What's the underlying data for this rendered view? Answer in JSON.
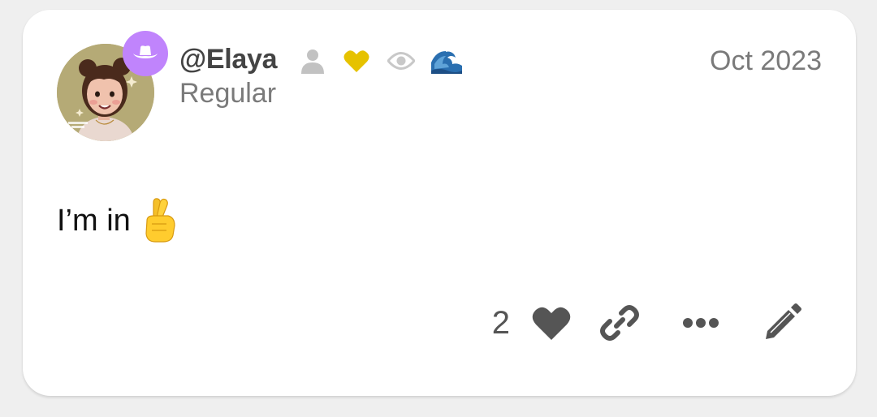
{
  "post": {
    "username": "@Elaya",
    "role": "Regular",
    "date": "Oct 2023",
    "message": "I’m in",
    "message_emoji": "crossed-fingers-emoji",
    "avatar_icon": "user-avatar",
    "flair_icon": "cowboy-hat-icon",
    "badges": [
      {
        "icon": "person-icon",
        "color": "#c2c2c2"
      },
      {
        "icon": "heart-icon",
        "color": "#e6c200"
      },
      {
        "icon": "eye-icon",
        "color": "#c8c8c8"
      },
      {
        "icon": "wave-emoji",
        "color": "#2a6fb0"
      }
    ]
  },
  "actions": {
    "like_count": "2",
    "icons": [
      "heart-icon",
      "link-icon",
      "more-icon",
      "edit-icon"
    ]
  },
  "colors": {
    "background": "#efefef",
    "card": "#ffffff",
    "flair": "#c084fc",
    "action_icon": "#555555",
    "muted_text": "#7a7a7a"
  }
}
